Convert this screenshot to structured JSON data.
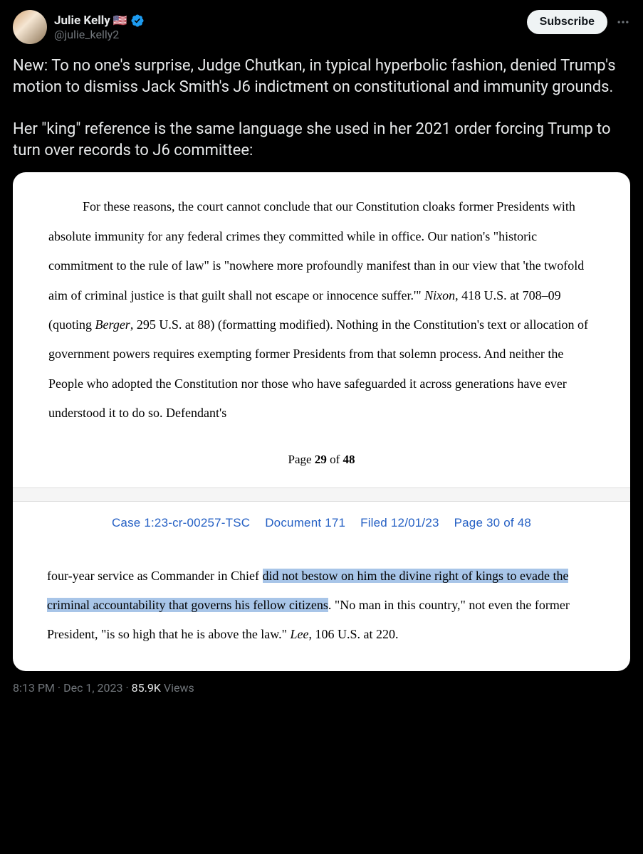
{
  "author": {
    "display_name": "Julie Kelly",
    "flag": "🇺🇸",
    "handle": "@julie_kelly2"
  },
  "actions": {
    "subscribe_label": "Subscribe"
  },
  "tweet_text": "New: To no one's surprise, Judge Chutkan, in typical hyperbolic fashion, denied Trump's motion to dismiss Jack Smith's J6 indictment on constitutional and immunity grounds.\n\nHer \"king\" reference is the same language she used in her 2021 order forcing Trump to turn over records to J6 committee:",
  "document": {
    "page1": {
      "text_before_nixon": "For these reasons, the court cannot conclude that our Constitution cloaks former Presidents with absolute immunity for any federal crimes they committed while in office.  Our nation's \"historic commitment to the rule of law\" is \"nowhere more profoundly manifest than in our view that 'the twofold aim of criminal justice is that guilt shall not escape or innocence suffer.'\"  ",
      "nixon": "Nixon",
      "text_mid": ", 418 U.S. at 708–09 (quoting ",
      "berger": "Berger",
      "text_after_berger": ", 295 U.S. at 88) (formatting modified).  Nothing in the Constitution's text or allocation of government powers requires exempting former Presidents from that solemn process.  And neither the People who adopted the Constitution nor those who have safeguarded it across generations have ever understood it to do so.  Defendant's",
      "page_label_prefix": "Page ",
      "page_current": "29",
      "page_of": " of ",
      "page_total": "48"
    },
    "header": {
      "case": "Case 1:23-cr-00257-TSC",
      "doc": "Document 171",
      "filed": "Filed 12/01/23",
      "page": "Page 30 of 48"
    },
    "page2": {
      "text_before_highlight": "four-year service as Commander in Chief ",
      "highlight": "did not bestow on him the divine right of kings to evade the criminal accountability that governs his fellow citizens",
      "text_after_highlight": ".  \"No man in this country,\" not even the former President, \"is so high that he is above the law.\"  ",
      "lee": "Lee",
      "citation": ", 106 U.S. at 220."
    }
  },
  "meta": {
    "time": "8:13 PM",
    "date": "Dec 1, 2023",
    "views_count": "85.9K",
    "views_label": " Views"
  }
}
